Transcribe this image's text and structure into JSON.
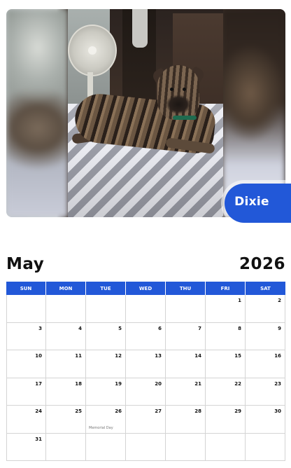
{
  "photo": {
    "pet_name": "Dixie"
  },
  "calendar": {
    "month": "May",
    "year": "2026",
    "weekdays": [
      "SUN",
      "MON",
      "TUE",
      "WED",
      "THU",
      "FRI",
      "SAT"
    ],
    "weeks": [
      [
        "",
        "",
        "",
        "",
        "",
        "1",
        "2"
      ],
      [
        "3",
        "4",
        "5",
        "6",
        "7",
        "8",
        "9"
      ],
      [
        "10",
        "11",
        "12",
        "13",
        "14",
        "15",
        "16"
      ],
      [
        "17",
        "18",
        "19",
        "20",
        "21",
        "22",
        "23"
      ],
      [
        "24",
        "25",
        "26",
        "27",
        "28",
        "29",
        "30"
      ],
      [
        "31",
        "",
        "",
        "",
        "",
        "",
        ""
      ]
    ],
    "holidays": {
      "memorial_day": "Memorial Day"
    }
  },
  "colors": {
    "accent": "#2258d8",
    "grid": "#d4d4d4",
    "text": "#111111"
  }
}
